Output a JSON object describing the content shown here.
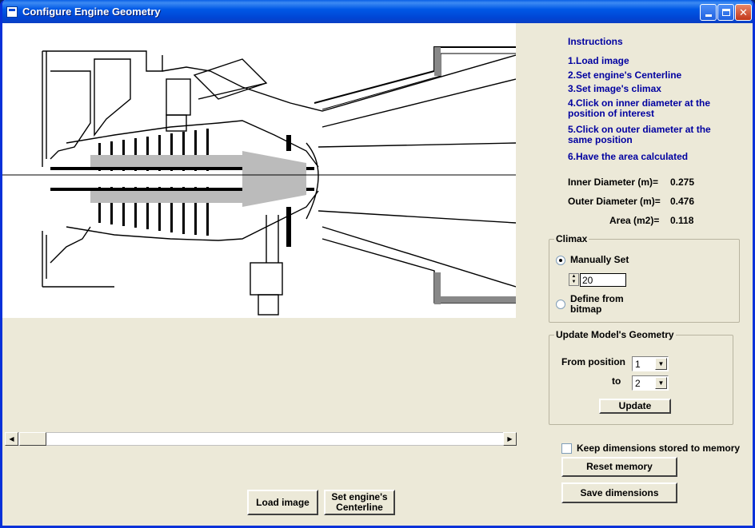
{
  "window": {
    "title": "Configure Engine Geometry"
  },
  "picture": {
    "description_icon": "engine-cross-section-drawing"
  },
  "instructions": {
    "heading": "Instructions",
    "steps": [
      "1.Load image",
      "2.Set engine's Centerline",
      "3.Set image's climax",
      "4.Click on  inner diameter at the",
      "position of interest",
      "5.Click on  outer diameter at the",
      "same  position",
      "6.Have the area calculated"
    ]
  },
  "measurements": {
    "inner_label": "Inner Diameter (m)=",
    "inner_value": "0.275",
    "outer_label": "Outer Diameter (m)=",
    "outer_value": "0.476",
    "area_label": "Area (m2)=",
    "area_value": "0.118"
  },
  "climax": {
    "title": "Climax",
    "manual_label": "Manually Set",
    "value": "20",
    "bitmap_label_1": "Define from",
    "bitmap_label_2": "bitmap"
  },
  "update": {
    "title": "Update Model's Geometry",
    "from_label": "From position",
    "from_value": "1",
    "to_label": "to",
    "to_value": "2",
    "button": "Update"
  },
  "memory": {
    "keep_label": "Keep dimensions stored to memory",
    "reset_button": "Reset memory",
    "save_button": "Save dimensions"
  },
  "bottom": {
    "load_button": "Load image",
    "center_button_1": "Set engine's",
    "center_button_2": "Centerline"
  }
}
